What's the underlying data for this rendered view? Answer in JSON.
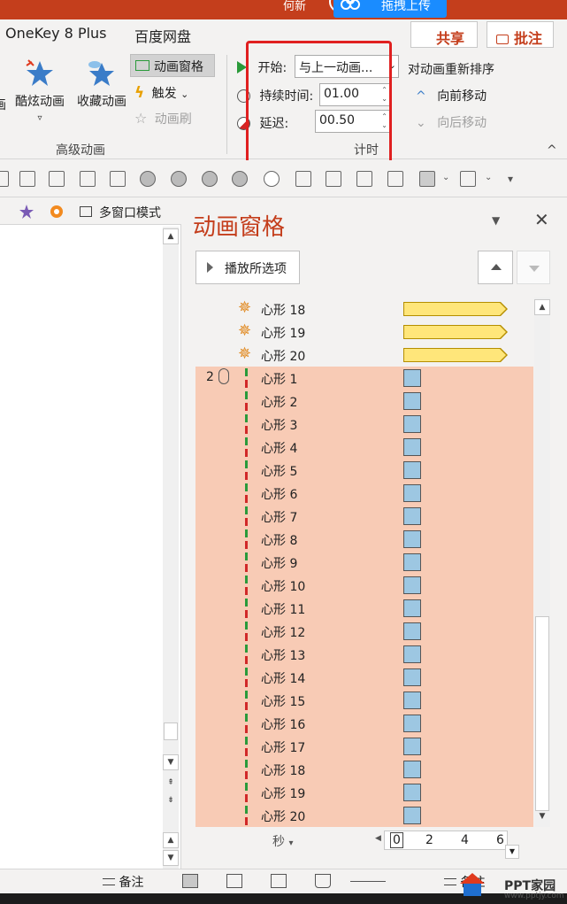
{
  "titlebar": {
    "user_name": "何新"
  },
  "upload_popup": {
    "label": "拖拽上传"
  },
  "ribbon": {
    "tabs": [
      "OneKey 8 Plus",
      "百度网盘"
    ],
    "share_label": "共享",
    "comment_label": "批注",
    "advanced": {
      "partial_label": "画",
      "cool_anim_label": "酷炫动画",
      "cool_anim_caret": "▿",
      "fav_anim_label": "收藏动画",
      "anim_pane_label": "动画窗格",
      "trigger_label": "触发",
      "trigger_caret": "⌄",
      "anim_brush_label": "动画刷",
      "group_label": "高级动画"
    },
    "timing": {
      "start_label": "开始:",
      "start_value": "与上一动画...",
      "duration_label": "持续时间:",
      "duration_value": "01.00",
      "delay_label": "延迟:",
      "delay_value": "00.50",
      "group_label": "计时"
    },
    "reorder": {
      "title": "对动画重新排序",
      "move_earlier": "向前移动",
      "move_later": "向后移动"
    },
    "collapse_glyph": "^"
  },
  "left_panel": {
    "multi_window_label": "多窗口模式"
  },
  "anim_pane": {
    "title": "动画窗格",
    "menu_glyph": "▼",
    "close_glyph": "✕",
    "play_label": "播放所选项",
    "items_top": [
      {
        "name": "心形 18"
      },
      {
        "name": "心形 19"
      },
      {
        "name": "心形 20"
      }
    ],
    "group_number": "2",
    "items_selected": [
      {
        "name": "心形 1"
      },
      {
        "name": "心形 2"
      },
      {
        "name": "心形 3"
      },
      {
        "name": "心形 4"
      },
      {
        "name": "心形 5"
      },
      {
        "name": "心形 6"
      },
      {
        "name": "心形 7"
      },
      {
        "name": "心形 8"
      },
      {
        "name": "心形 9"
      },
      {
        "name": "心形 10"
      },
      {
        "name": "心形 11"
      },
      {
        "name": "心形 12"
      },
      {
        "name": "心形 13"
      },
      {
        "name": "心形 14"
      },
      {
        "name": "心形 15"
      },
      {
        "name": "心形 16"
      },
      {
        "name": "心形 17"
      },
      {
        "name": "心形 18"
      },
      {
        "name": "心形 19"
      },
      {
        "name": "心形 20"
      }
    ],
    "timeline": {
      "seconds_label": "秒",
      "seconds_caret": "▾",
      "ticks": [
        "0",
        "2",
        "4",
        "6"
      ]
    }
  },
  "statusbar": {
    "notes_label": "备注"
  },
  "watermark": {
    "text": "PPT家园",
    "url": "www.pptjy.com"
  },
  "colors": {
    "accent": "#c43e1c",
    "selection": "#f8cbb5",
    "emphasis_bar": "#ffe67a",
    "entrance_square": "#9dc7e2",
    "highlight_box": "#e02020"
  }
}
